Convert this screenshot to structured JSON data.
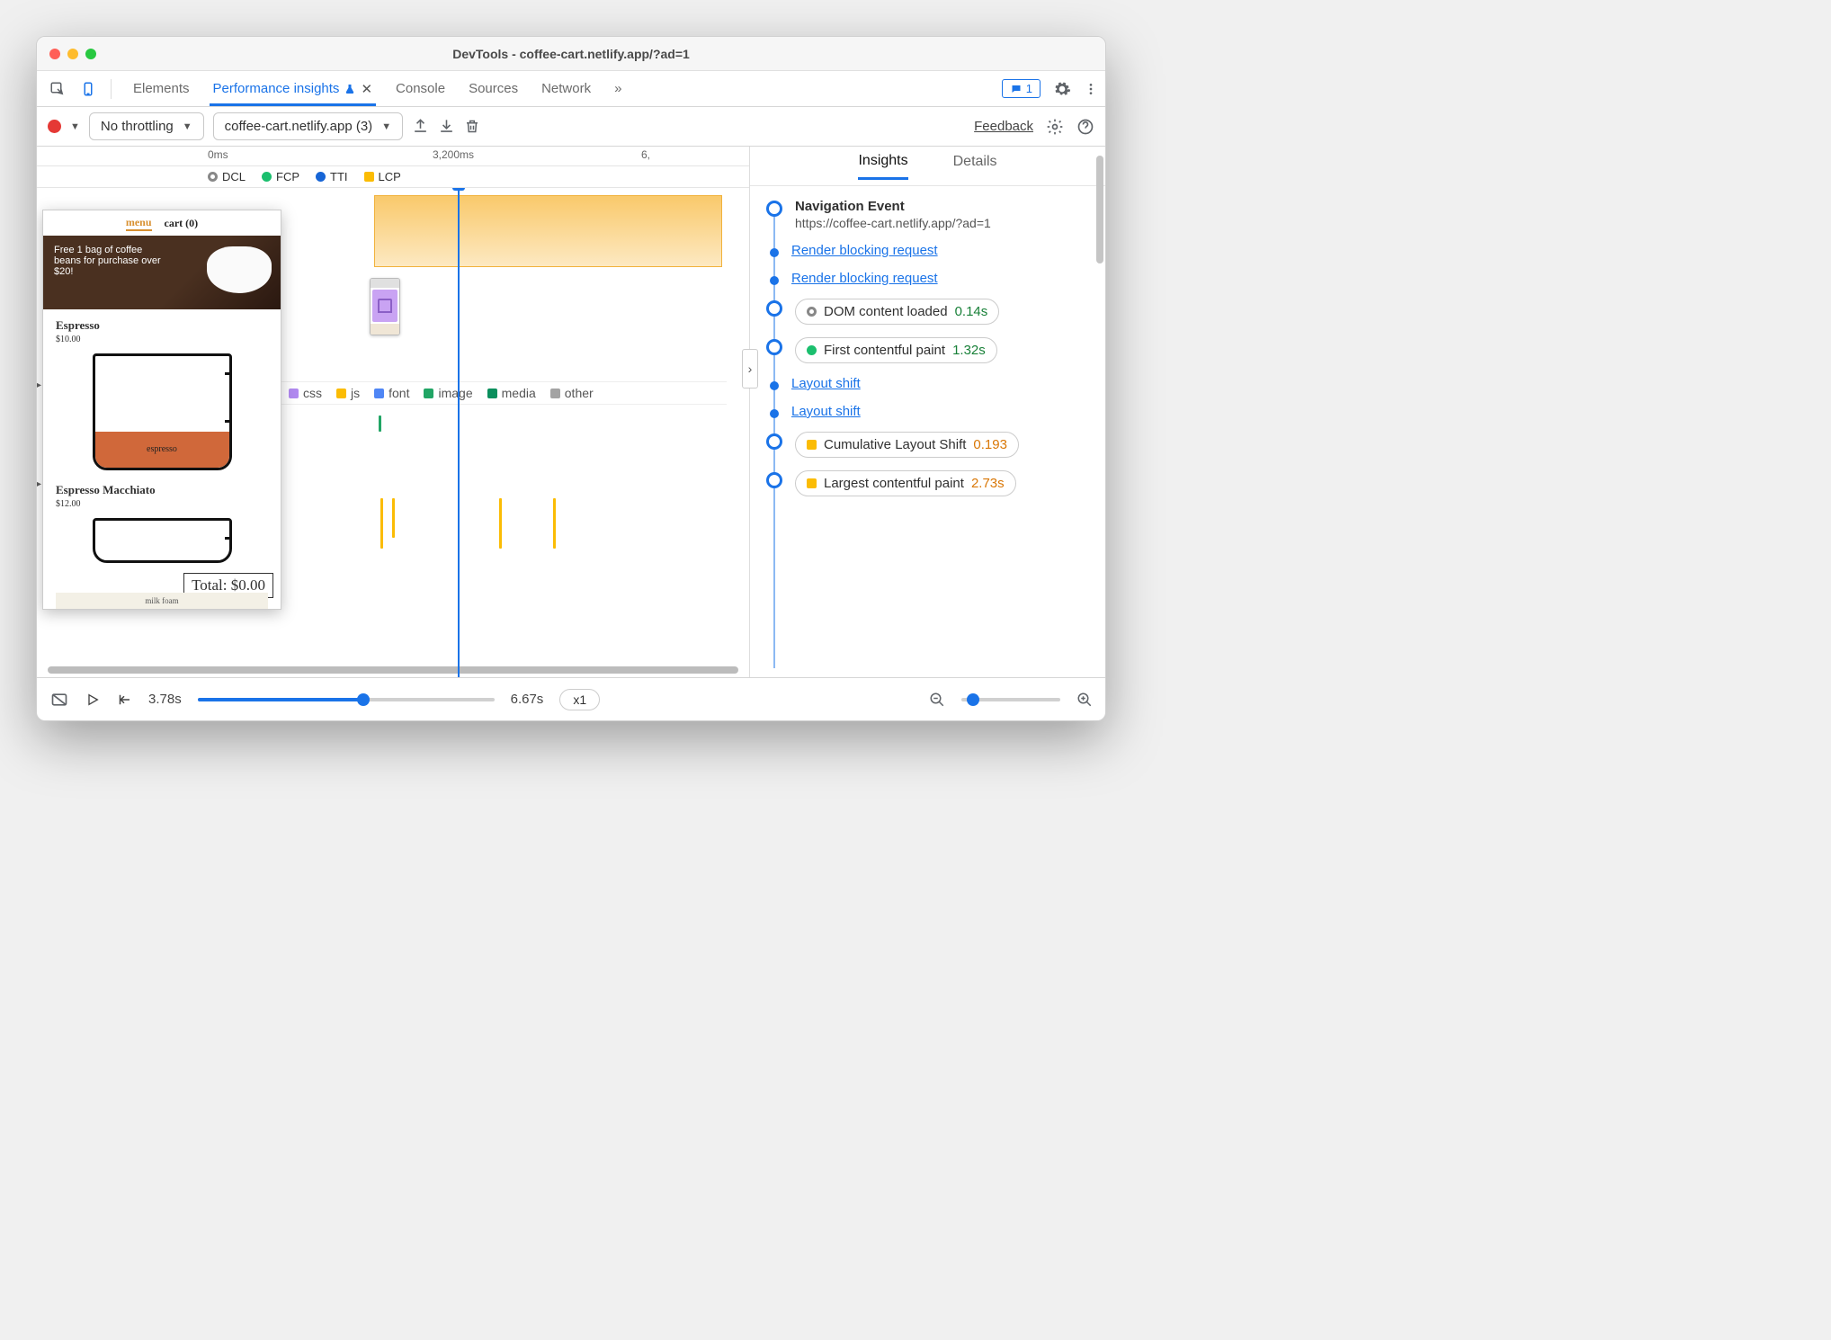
{
  "window": {
    "title": "DevTools - coffee-cart.netlify.app/?ad=1"
  },
  "tabs": {
    "items": [
      "Elements",
      "Performance insights",
      "Console",
      "Sources",
      "Network"
    ],
    "active_index": 1,
    "overflow_glyph": "»",
    "messages_count": "1"
  },
  "toolbar": {
    "throttling": "No throttling",
    "recording": "coffee-cart.netlify.app (3)",
    "feedback": "Feedback"
  },
  "ruler": {
    "t0": "0ms",
    "t1": "3,200ms",
    "t2": "6,"
  },
  "markers": {
    "dcl": "DCL",
    "fcp": "FCP",
    "tti": "TTI",
    "lcp": "LCP"
  },
  "resource_legend": {
    "css": "css",
    "js": "js",
    "font": "font",
    "image": "image",
    "media": "media",
    "other": "other"
  },
  "preview": {
    "menu": "menu",
    "cart": "cart (0)",
    "banner": "Free 1 bag of coffee beans for purchase over $20!",
    "item1_name": "Espresso",
    "item1_price": "$10.00",
    "item1_fill": "espresso",
    "item2_name": "Espresso Macchiato",
    "item2_price": "$12.00",
    "total": "Total: $0.00",
    "foam": "milk foam"
  },
  "right": {
    "tabs": {
      "insights": "Insights",
      "details": "Details"
    },
    "nav_title": "Navigation Event",
    "nav_url": "https://coffee-cart.netlify.app/?ad=1",
    "rbr": "Render blocking request",
    "dcl_label": "DOM content loaded",
    "dcl_val": "0.14s",
    "fcp_label": "First contentful paint",
    "fcp_val": "1.32s",
    "ls": "Layout shift",
    "cls_label": "Cumulative Layout Shift",
    "cls_val": "0.193",
    "lcp_label": "Largest contentful paint",
    "lcp_val": "2.73s"
  },
  "footer": {
    "current": "3.78s",
    "total": "6.67s",
    "speed": "x1"
  },
  "colors": {
    "css": "#b18af0",
    "js": "#fbbc04",
    "font": "#4f86f5",
    "image": "#21a565",
    "media": "#0b8f5d",
    "other": "#a3a3a3",
    "orange_val": "#d97706",
    "green_val": "#188038"
  }
}
